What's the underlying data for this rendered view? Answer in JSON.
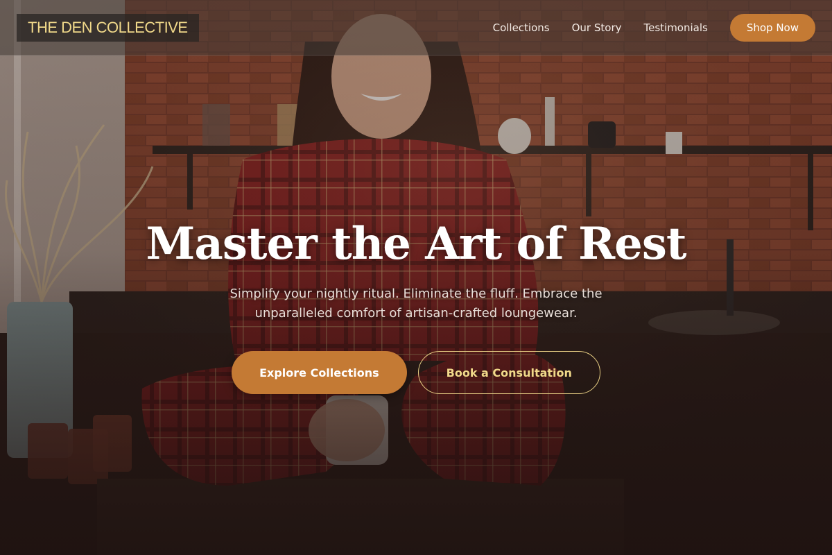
{
  "nav": {
    "logo_text": "THE DEN COLLECTIVE",
    "links": [
      {
        "label": "Collections"
      },
      {
        "label": "Our Story"
      },
      {
        "label": "Testimonials"
      }
    ],
    "shop_label": "Shop Now"
  },
  "hero": {
    "title": "Master the Art of Rest",
    "subtitle": "Simplify your nightly ritual. Eliminate the fluff. Embrace the unparalleled comfort of artisan-crafted loungewear.",
    "primary_cta": "Explore Collections",
    "secondary_cta": "Book a Consultation"
  },
  "colors": {
    "accent": "#c47a34",
    "logo_gold": "#f1d98a",
    "background": "#1f1412"
  },
  "icons": [
    "plaid-pajama-hero-photo"
  ]
}
